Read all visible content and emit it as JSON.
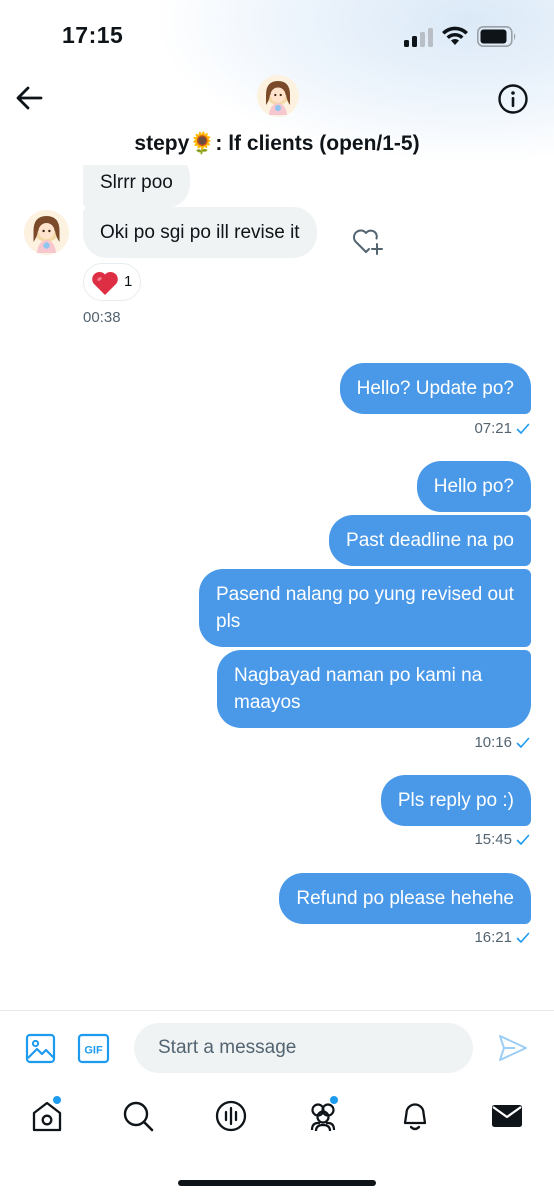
{
  "status_bar": {
    "time": "17:15"
  },
  "header": {
    "title": "stepy🌻: lf clients (open/1-5)"
  },
  "messages": {
    "received": [
      {
        "text": "Slrrr poo"
      },
      {
        "text": "Oki po sgi po ill revise it"
      }
    ],
    "received_reaction": {
      "emoji": "heart",
      "count": "1"
    },
    "received_time": "00:38",
    "sent_groups": [
      {
        "messages": [
          "Hello? Update po?"
        ],
        "time": "07:21"
      },
      {
        "messages": [
          "Hello po?",
          "Past deadline na po",
          "Pasend nalang po yung revised out pls",
          "Nagbayad naman po kami na maayos"
        ],
        "time": "10:16"
      },
      {
        "messages": [
          "Pls reply po :)"
        ],
        "time": "15:45"
      },
      {
        "messages": [
          "Refund po please hehehe"
        ],
        "time": "16:21"
      }
    ]
  },
  "composer": {
    "placeholder": "Start a message"
  },
  "colors": {
    "accent": "#1d9bf0",
    "sent_bubble": "#4a99e9",
    "received_bubble": "#eff3f4"
  },
  "bottom_nav": [
    "home-icon",
    "search-icon",
    "spaces-icon",
    "communities-icon",
    "notifications-icon",
    "messages-icon"
  ]
}
